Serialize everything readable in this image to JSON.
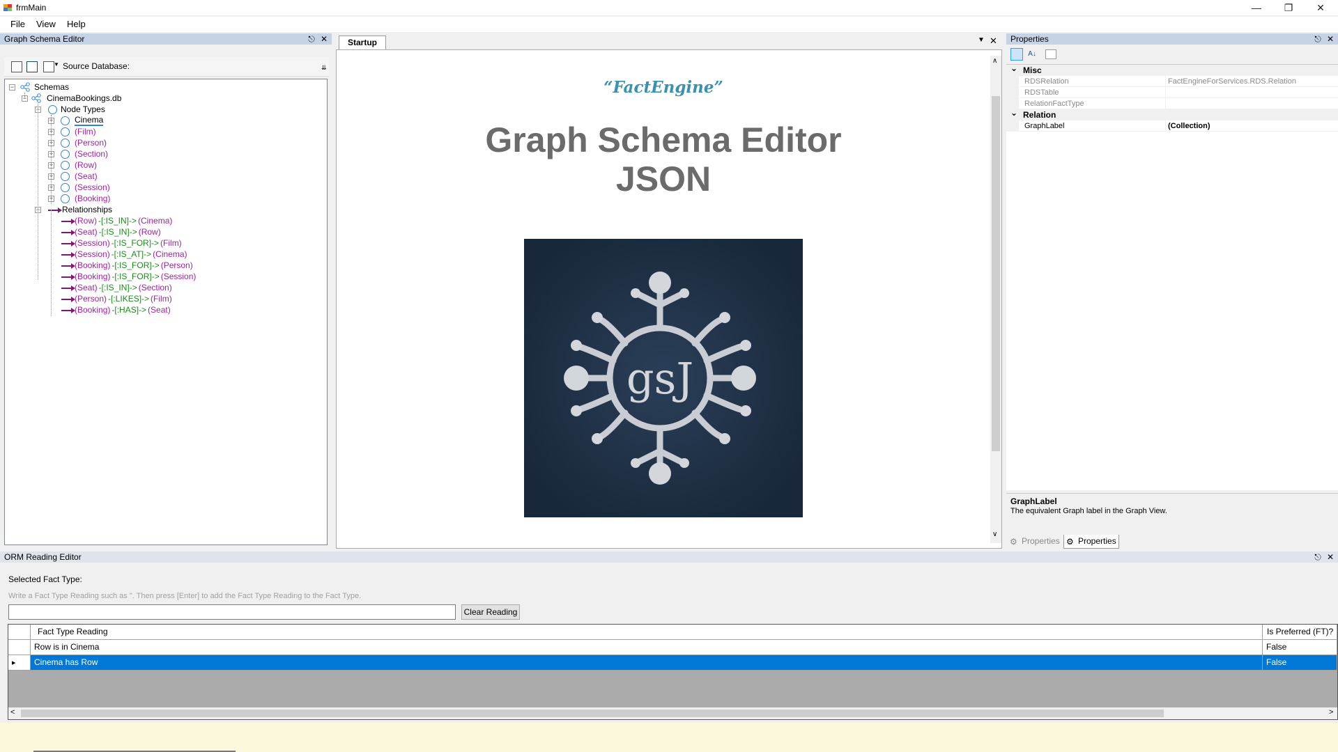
{
  "window": {
    "title": "frmMain"
  },
  "menu": {
    "file": "File",
    "view": "View",
    "help": "Help"
  },
  "left_panel": {
    "title": "Graph Schema Editor",
    "source_db_label": "Source Database:",
    "tree": {
      "root": "Schemas",
      "db": "CinemaBookings.db",
      "node_types_label": "Node Types",
      "node_types": [
        "Cinema",
        "(Film)",
        "(Person)",
        "(Section)",
        "(Row)",
        "(Seat)",
        "(Session)",
        "(Booking)"
      ],
      "relationships_label": "Relationships",
      "relationships": [
        {
          "from": "(Row)",
          "rel": "-[:IS_IN]->",
          "to": "(Cinema)"
        },
        {
          "from": "(Seat)",
          "rel": "-[:IS_IN]->",
          "to": "(Row)"
        },
        {
          "from": "(Session)",
          "rel": "-[:IS_FOR]->",
          "to": "(Film)"
        },
        {
          "from": "(Session)",
          "rel": "-[:IS_AT]->",
          "to": "(Cinema)"
        },
        {
          "from": "(Booking)",
          "rel": "-[:IS_FOR]->",
          "to": "(Person)"
        },
        {
          "from": "(Booking)",
          "rel": "-[:IS_FOR]->",
          "to": "(Session)"
        },
        {
          "from": "(Seat)",
          "rel": "-[:IS_IN]->",
          "to": "(Section)"
        },
        {
          "from": "(Person)",
          "rel": "-[:LIKES]->",
          "to": "(Film)"
        },
        {
          "from": "(Booking)",
          "rel": "-[:HAS]->",
          "to": "(Seat)"
        }
      ]
    }
  },
  "document": {
    "tab": "Startup",
    "brand": "“FactEngine”",
    "title_line1": "Graph Schema Editor",
    "title_line2": "JSON",
    "logo_text": "gsJ"
  },
  "properties": {
    "title": "Properties",
    "categories": [
      {
        "name": "Misc",
        "rows": [
          {
            "name": "RDSRelation",
            "value": "FactEngineForServices.RDS.Relation"
          },
          {
            "name": "RDSTable",
            "value": ""
          },
          {
            "name": "RelationFactType",
            "value": ""
          }
        ]
      },
      {
        "name": "Relation",
        "rows": [
          {
            "name": "GraphLabel",
            "value": "(Collection)"
          }
        ]
      }
    ],
    "desc_title": "GraphLabel",
    "desc_text": "The equivalent Graph label in the Graph View.",
    "tabs": [
      "Properties",
      "Properties"
    ]
  },
  "bottom_panel": {
    "title": "ORM Reading Editor",
    "selected_label": "Selected Fact Type:",
    "hint": "Write a Fact Type Reading such as \". Then press [Enter] to add the Fact Type Reading to the Fact Type.",
    "clear_button": "Clear Reading",
    "grid": {
      "headers": [
        "Fact Type Reading",
        "Is Preferred (FT)?"
      ],
      "rows": [
        {
          "reading": "Row is in Cinema",
          "preferred": "False",
          "selected": false
        },
        {
          "reading": "Cinema has Row",
          "preferred": "False",
          "selected": true
        }
      ]
    }
  },
  "colors": {
    "accent_selection": "#0078d7",
    "dock_header": "#c4d3e6",
    "brand": "#3b8fb0",
    "relation_arrow": "#7a1a6a",
    "node_label": "#a020a0",
    "rel_label": "#2e8b2e"
  }
}
